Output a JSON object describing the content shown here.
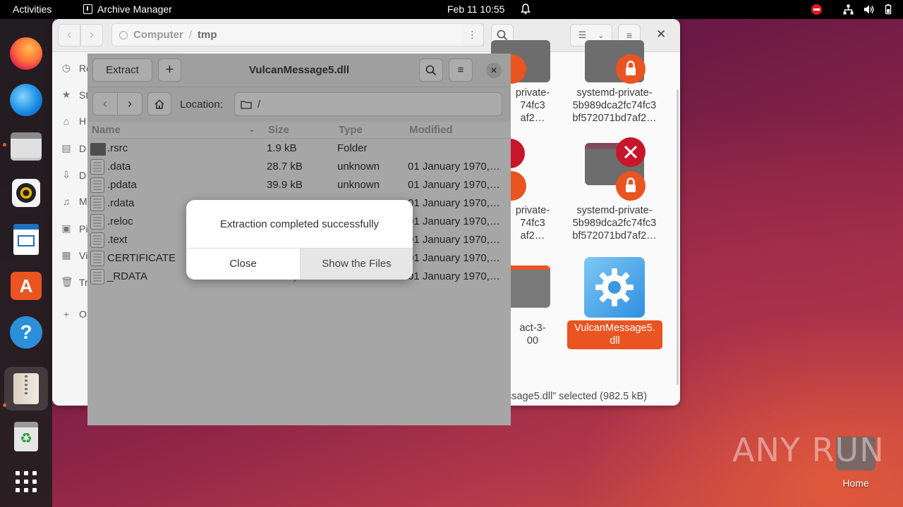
{
  "topbar": {
    "activities": "Activities",
    "app_name": "Archive Manager",
    "clock": "Feb 11  10:55"
  },
  "dock": {
    "items": [
      "firefox-icon",
      "thunderbird-icon",
      "files-icon",
      "rhythmbox-icon",
      "libreoffice-writer-icon",
      "app-center-icon",
      "help-icon",
      "archive-manager-icon",
      "trash-icon",
      "show-apps-icon"
    ]
  },
  "files": {
    "path": [
      "Computer",
      "tmp"
    ],
    "sidebar": [
      "Re",
      "St",
      "H",
      "D",
      "D",
      "M",
      "Pi",
      "Vi",
      "Tr",
      "O"
    ],
    "tiles": [
      {
        "label": "private-\n74fc3\naf2…"
      },
      {
        "label": "systemd-private-\n5b989dca2fc74fc3\nbf572071bd7af2…"
      },
      {
        "label": "private-\n74fc3\naf2…"
      },
      {
        "label": "systemd-private-\n5b989dca2fc74fc3\nbf572071bd7af2…"
      },
      {
        "label": "act-3-\n00"
      },
      {
        "label": "VulcanMessage5.\ndll"
      }
    ],
    "status": "ssage5.dll” selected  (982.5 kB)"
  },
  "archive": {
    "extract_label": "Extract",
    "add_label": "+",
    "title": "VulcanMessage5.dll",
    "location_label": "Location:",
    "location_value": "/",
    "columns": {
      "name": "Name",
      "size": "Size",
      "type": "Type",
      "modified": "Modified"
    },
    "rows": [
      {
        "name": ".rsrc",
        "size": "1.9 kB",
        "type": "Folder",
        "modified": "",
        "dir": true
      },
      {
        "name": ".data",
        "size": "28.7 kB",
        "type": "unknown",
        "modified": "01 January 1970,…"
      },
      {
        "name": ".pdata",
        "size": "39.9 kB",
        "type": "unknown",
        "modified": "01 January 1970,…"
      },
      {
        "name": ".rdata",
        "size": "",
        "type": "",
        "modified": "01 January 1970,…"
      },
      {
        "name": ".reloc",
        "size": "",
        "type": "",
        "modified": "01 January 1970,…"
      },
      {
        "name": ".text",
        "size": "",
        "type": "",
        "modified": "01 January 1970,…"
      },
      {
        "name": "CERTIFICATE",
        "size": "",
        "type": "",
        "modified": "01 January 1970,…"
      },
      {
        "name": "_RDATA",
        "size": "512 bytes",
        "type": "unknown",
        "modified": "01 January 1970,…"
      }
    ]
  },
  "dialog": {
    "message": "Extraction completed successfully",
    "close": "Close",
    "show_files": "Show the Files"
  },
  "desktop": {
    "home_label": "Home",
    "watermark": "ANY RUN"
  }
}
